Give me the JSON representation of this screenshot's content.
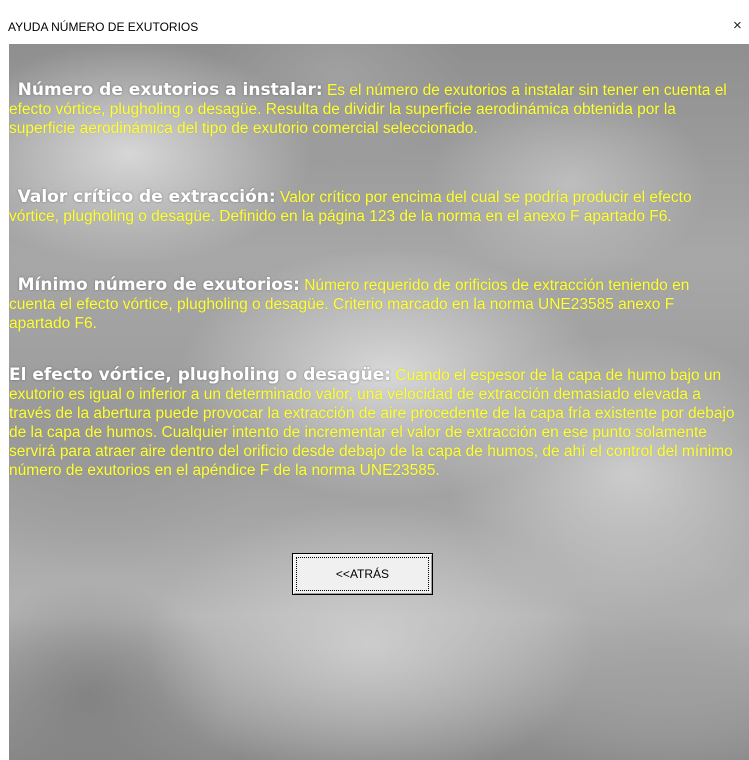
{
  "window": {
    "title": "AYUDA NÚMERO DE EXUTORIOS",
    "close_label": "×"
  },
  "help": {
    "items": [
      {
        "term": "Número de exutorios a instalar:",
        "description": "Es el número de exutorios a instalar sin tener en cuenta el efecto vórtice, plugholing o desagüe. Resulta de dividir la superficie aerodinámica obtenida por la superficie aerodinámica del tipo de exutorio comercial seleccionado."
      },
      {
        "term": "Valor crítico de extracción:",
        "description": "Valor crítico por encima del cual se podría producir el efecto vórtice, plugholing o desagüe. Definido en la página 123 de la norma en el anexo F apartado F6."
      },
      {
        "term": "Mínimo número de exutorios:",
        "description": "Número requerido de orificios de extracción teniendo en cuenta el efecto vórtice, plugholing o desagüe. Criterio marcado en la norma UNE23585 anexo F apartado F6."
      },
      {
        "term": "El efecto vórtice, plugholing o desagüe:",
        "description": "Cuando el espesor de la capa de humo bajo un exutorio es igual o inferior a un determinado valor, una velocidad de extracción demasiado elevada a través de la abertura puede provocar la extracción de aire procedente de la capa fría existente por debajo de la capa de humos. Cualquier intento de incrementar el valor de extracción en ese punto solamente servirá para atraer aire dentro del orificio desde debajo de la capa de humos, de ahí el control del mínimo número de exutorios en el apéndice F de la norma UNE23585."
      }
    ]
  },
  "back_button": {
    "label": "<<ATRÁS"
  },
  "colors": {
    "term_text": "#ffffff",
    "description_text": "#ffff33",
    "background_theme": "smoke-gray"
  }
}
